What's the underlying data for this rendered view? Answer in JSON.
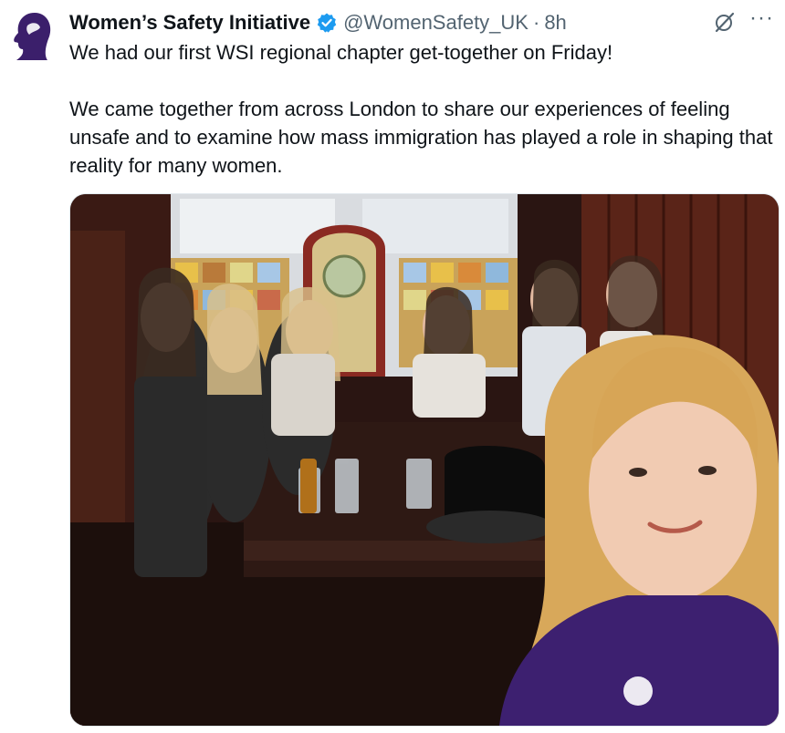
{
  "tweet": {
    "author_name": "Women’s Safety Initiative",
    "handle": "@WomenSafety_UK",
    "separator": "·",
    "time": "8h",
    "paragraphs": [
      "We had our first WSI regional chapter get-together on Friday!",
      "We came together from across London to share our experiences of feeling unsafe and to examine how mass immigration has played a role in shaping that reality for many women."
    ]
  },
  "icons": {
    "verified": "verified-badge-icon",
    "grok": "grok-icon",
    "more": "more-options-icon"
  },
  "colors": {
    "text": "#0f1419",
    "secondary": "#536471",
    "verified": "#1d9bf0",
    "brand_purple": "#3b1f6b"
  }
}
